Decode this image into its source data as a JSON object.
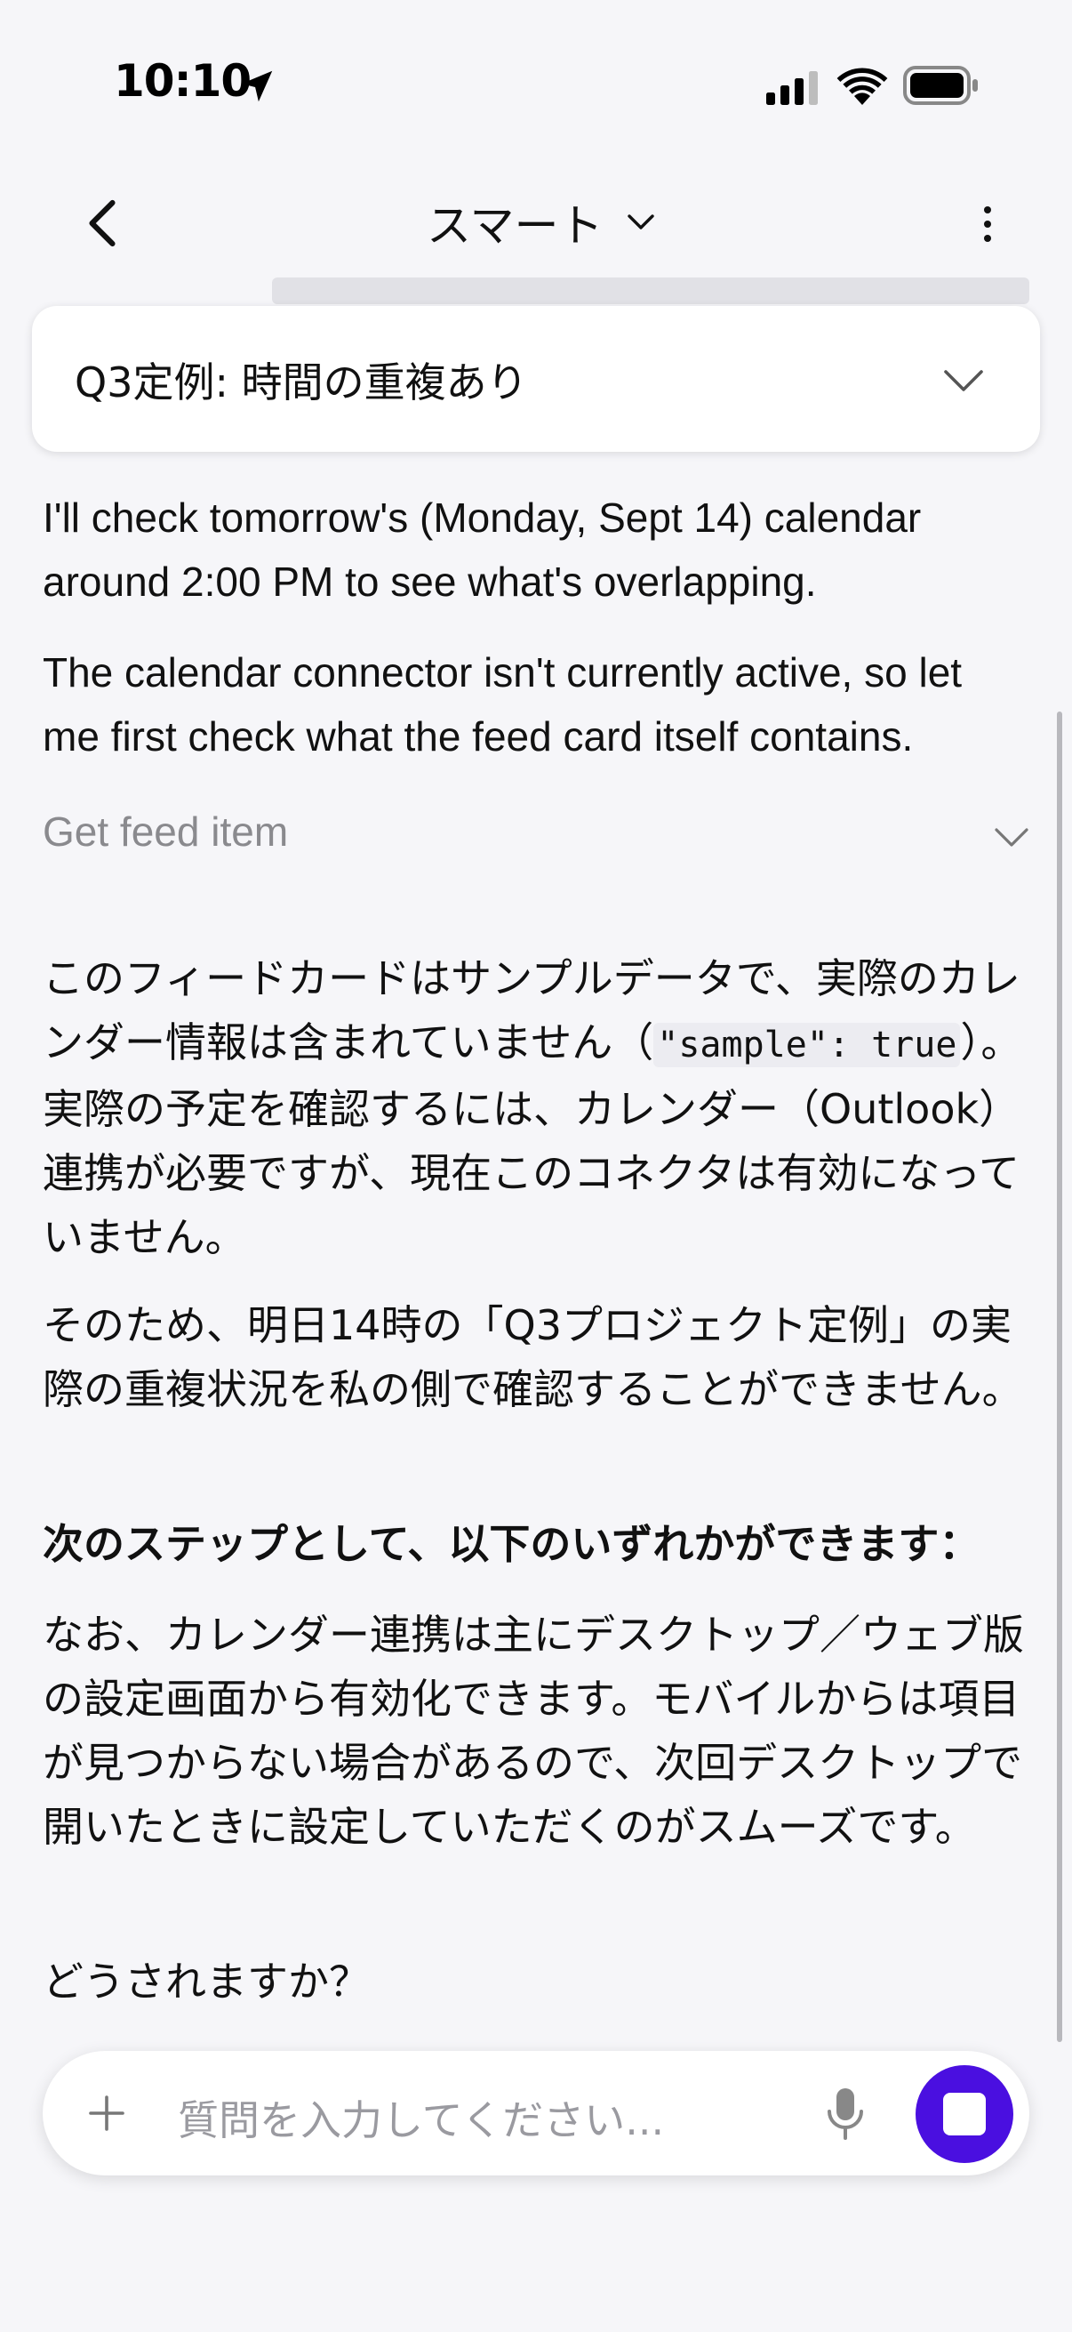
{
  "status_bar": {
    "time": "10:10"
  },
  "header": {
    "mode_label": "スマート"
  },
  "conversation": {
    "title": "Q3定例: 時間の重複あり"
  },
  "message": {
    "para1": "I'll check tomorrow's (Monday, Sept 14) calendar around 2:00 PM to see what's overlapping.",
    "para2": "The calendar connector isn't currently active, so let me first check what the feed card itself contains.",
    "tool_label": "Get feed item",
    "para3_a": "このフィードカードはサンプルデータで、実際のカレンダー情報は含まれていません（",
    "para3_code": "\"sample\": true",
    "para3_b": "）。実際の予定を確認するには、カレンダー（Outlook）連携が必要ですが、現在このコネクタは有効になっていません。",
    "para4": "そのため、明日14時の「Q3プロジェクト定例」の実際の重複状況を私の側で確認することができません。",
    "para5": "次のステップとして、以下のいずれかができます：",
    "para6": "なお、カレンダー連携は主にデスクトップ／ウェブ版の設定画面から有効化できます。モバイルからは項目が見つからない場合があるので、次回デスクトップで開いたときに設定していただくのがスムーズです。",
    "para7": "どうされますか？"
  },
  "input": {
    "placeholder": "質問を入力してください..."
  },
  "icons": {
    "location": "location-arrow-icon",
    "signal": "cellular-signal-icon",
    "wifi": "wifi-icon",
    "battery": "battery-icon",
    "back": "chevron-left-icon",
    "mode": "chevron-down-icon",
    "menu": "more-vertical-icon",
    "plus": "plus-icon",
    "mic": "microphone-icon",
    "stop": "stop-icon"
  },
  "colors": {
    "accent": "#4a0fe0",
    "background": "#f6f6f9"
  }
}
